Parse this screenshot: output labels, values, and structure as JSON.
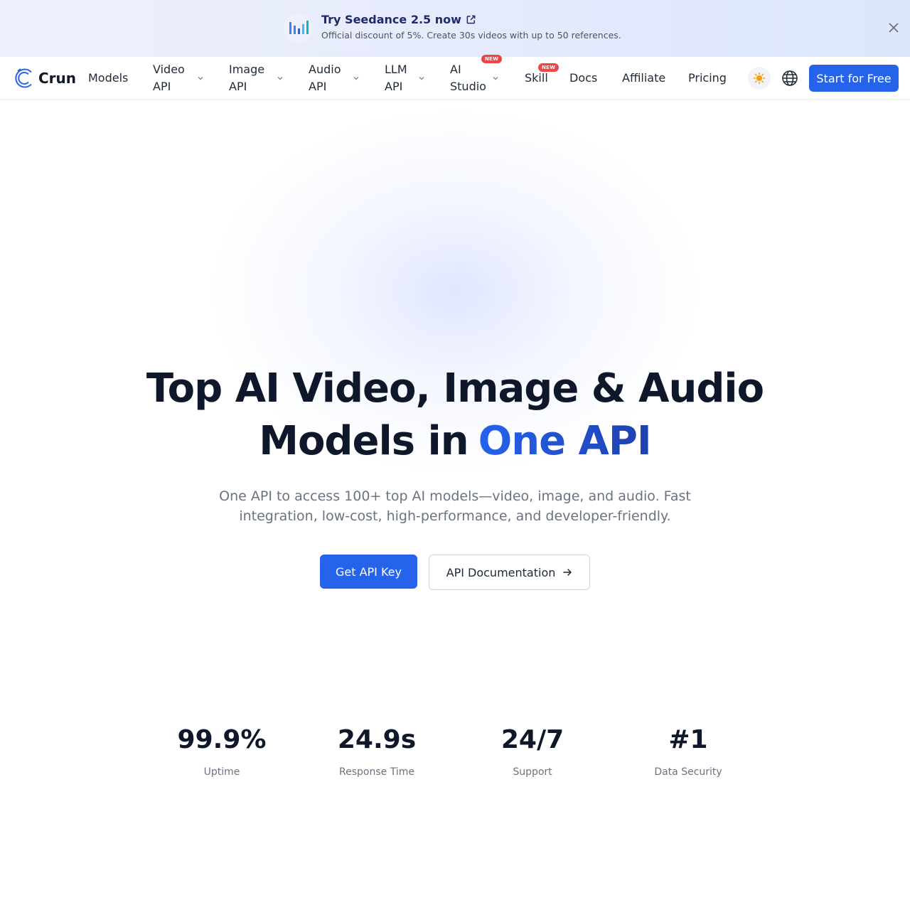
{
  "banner": {
    "title": "Try Seedance 2.5 now",
    "subtitle": "Official discount of 5%. Create 30s videos with up to 50 references.",
    "icon": "bar-chart-icon",
    "close_icon": "close-icon"
  },
  "nav": {
    "logo": "Crun",
    "items": [
      {
        "label": "Models"
      },
      {
        "label_1": "Video",
        "label_2": "API"
      },
      {
        "label_1": "Image",
        "label_2": "API"
      },
      {
        "label_1": "Audio",
        "label_2": "API"
      },
      {
        "label_1": "LLM",
        "label_2": "API"
      },
      {
        "label_1": "AI",
        "label_2": "Studio",
        "badge": "NEW"
      },
      {
        "label": "Skill",
        "badge": "NEW"
      },
      {
        "label": "Docs"
      },
      {
        "label": "Affiliate"
      },
      {
        "label": "Pricing"
      }
    ],
    "theme_icon": "sun-icon",
    "language_icon": "globe-icon",
    "cta": "Start for Free"
  },
  "hero": {
    "title_line1": "Top AI Video, Image & Audio",
    "title_line2": "Models in",
    "title_accent": "One API",
    "subtitle": "One API to access 100+ top AI models—video, image, and audio. Fast integration, low-cost, high-performance, and developer-friendly.",
    "primary_button": "Get API Key",
    "secondary_button": "API Documentation"
  },
  "stats": [
    {
      "value": "99.9%",
      "label": "Uptime"
    },
    {
      "value": "24.9s",
      "label": "Response Time"
    },
    {
      "value": "24/7",
      "label": "Support"
    },
    {
      "value": "#1",
      "label": "Data Security"
    }
  ],
  "colors": {
    "brand": "#2563eb",
    "badge": "#ef4444",
    "text": "#0f172a",
    "muted": "#6b7280"
  }
}
